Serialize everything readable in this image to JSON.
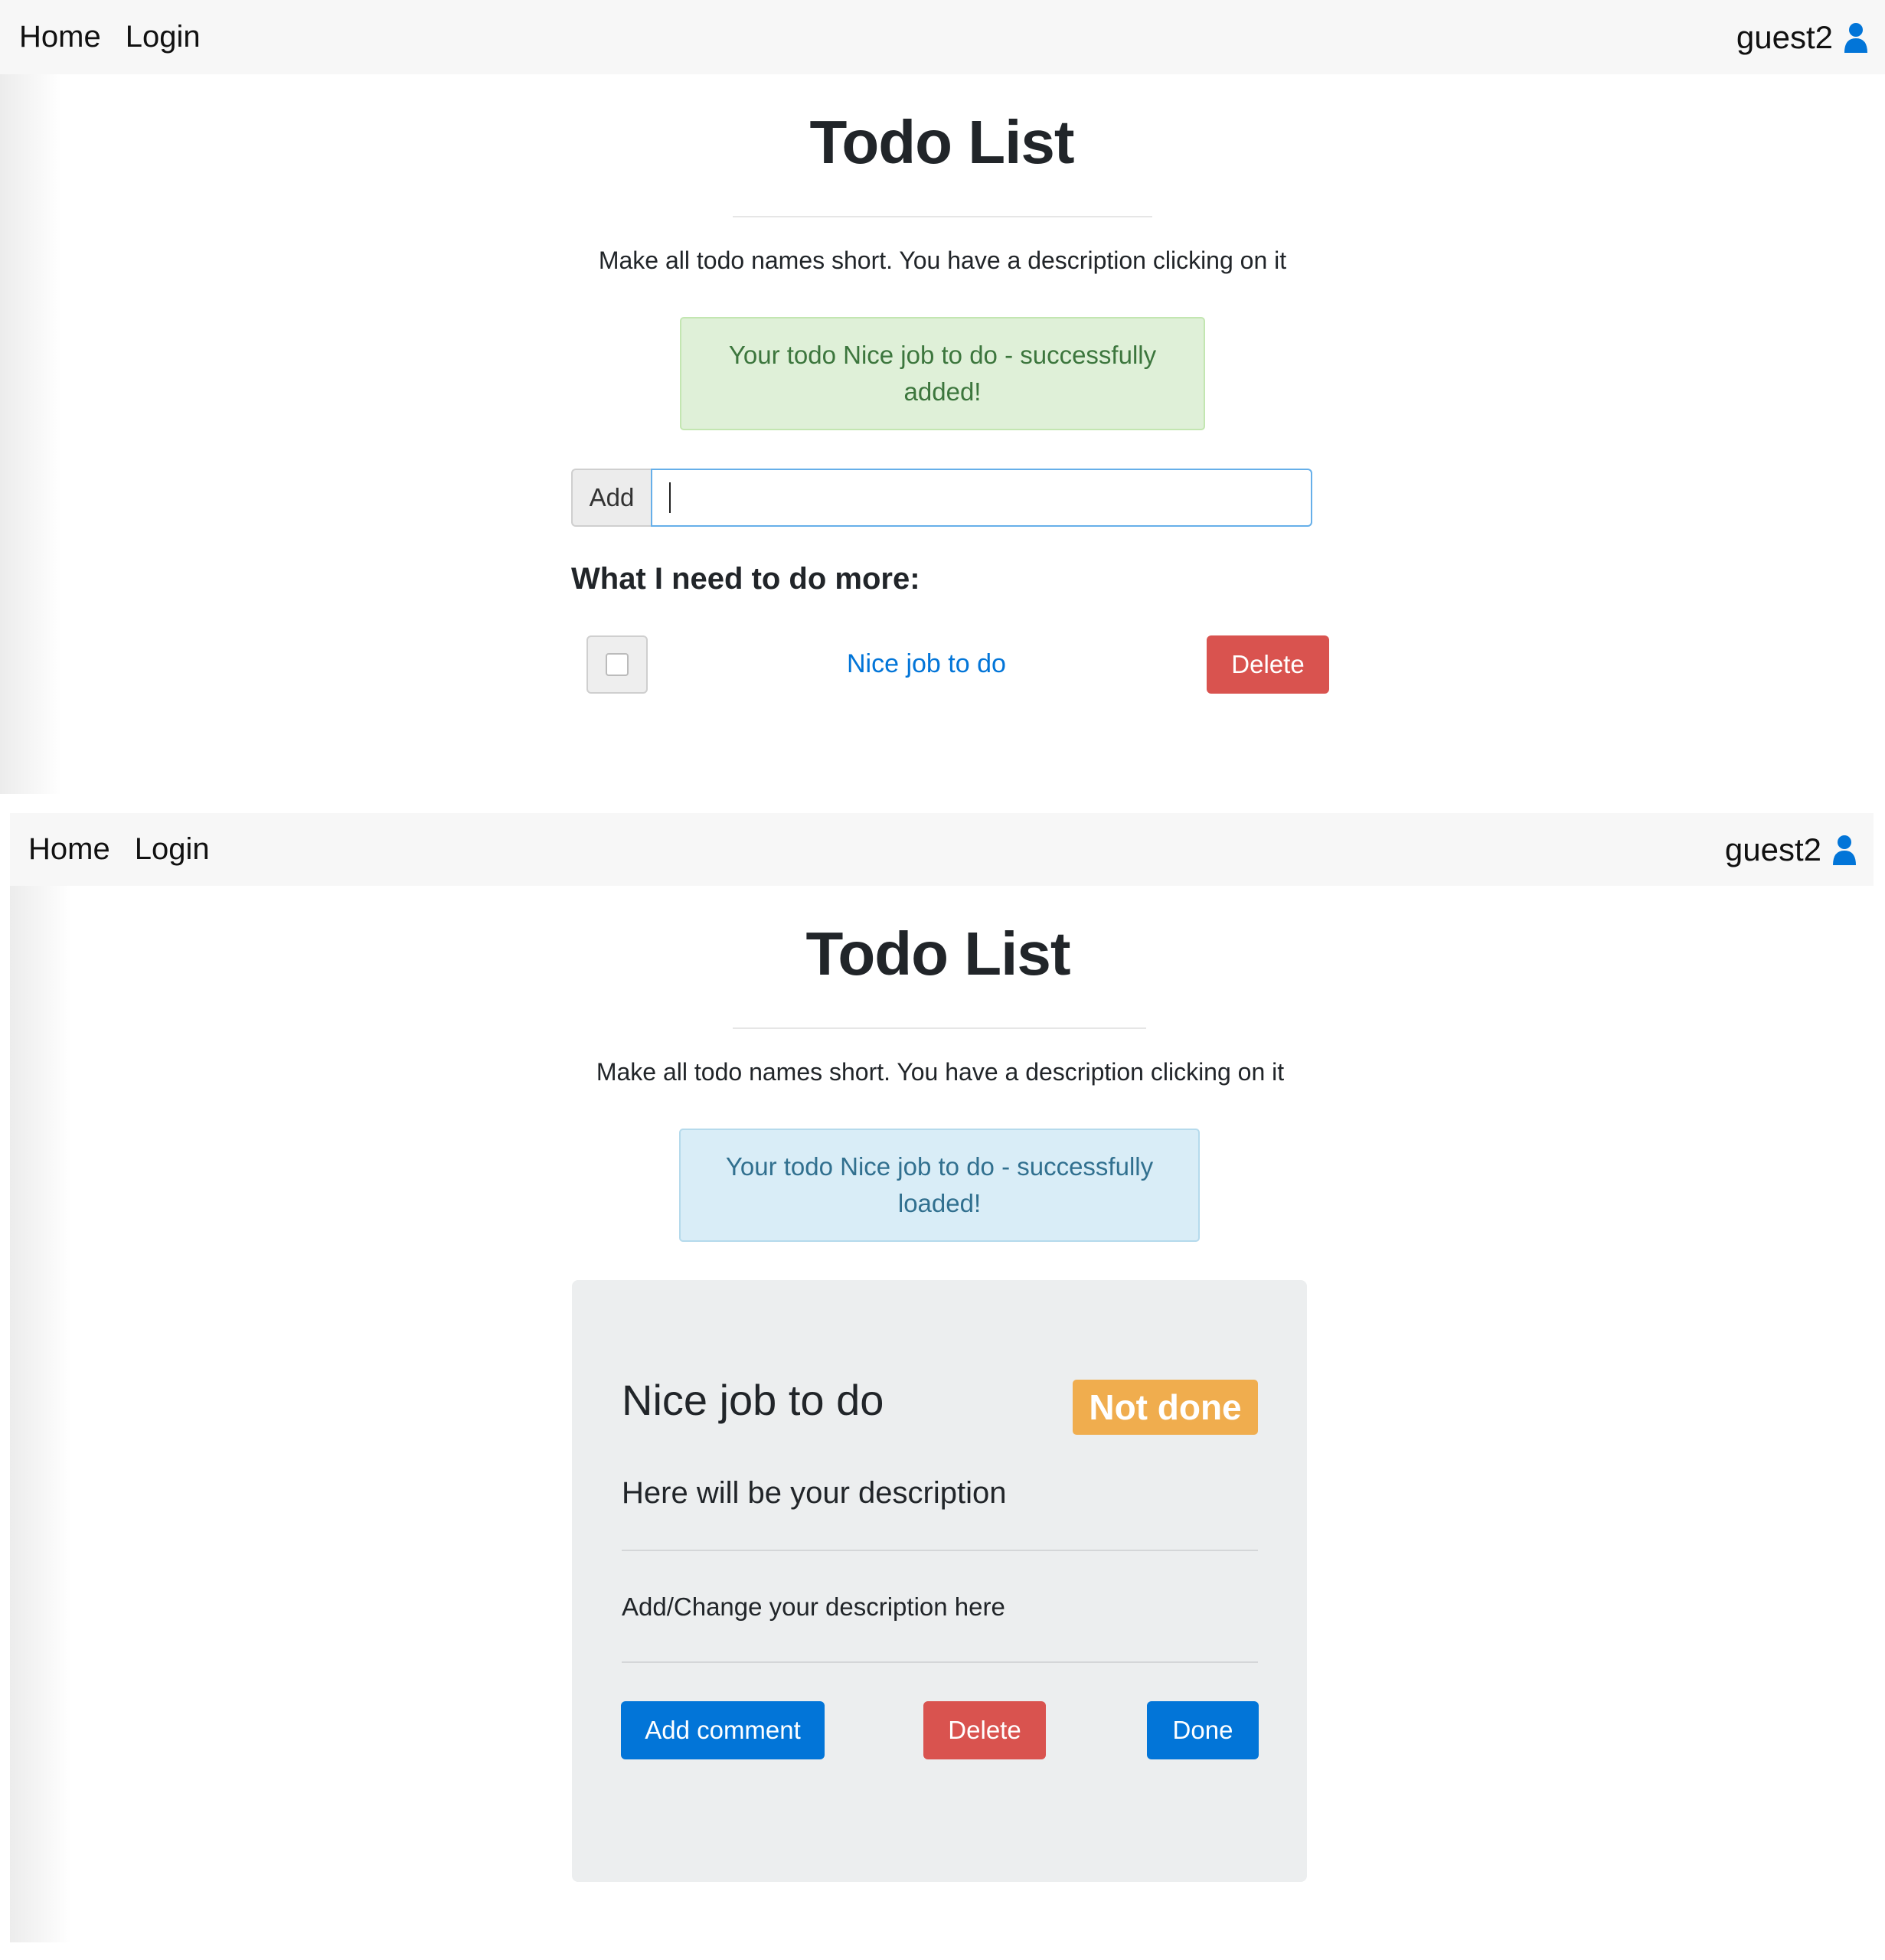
{
  "screens": [
    {
      "navbar": {
        "links": [
          "Home",
          "Login"
        ],
        "user": "guest2",
        "user_icon": "user-icon"
      },
      "title": "Todo List",
      "intro": "Make all todo names short. You have a description clicking on it",
      "alert": {
        "type": "success",
        "line1": "Your todo Nice job to do - successfully",
        "line2": "added!"
      },
      "add_form": {
        "button": "Add",
        "input_value": ""
      },
      "list_heading": "What I need to do more:",
      "todos": [
        {
          "name": "Nice job to do",
          "checked": false,
          "delete_label": "Delete"
        }
      ]
    },
    {
      "navbar": {
        "links": [
          "Home",
          "Login"
        ],
        "user": "guest2",
        "user_icon": "user-icon"
      },
      "title": "Todo List",
      "intro": "Make all todo names short. You have a description clicking on it",
      "alert": {
        "type": "info",
        "line1": "Your todo Nice job to do - successfully",
        "line2": "loaded!"
      },
      "detail": {
        "name": "Nice job to do",
        "status": "Not done",
        "description": "Here will be your description",
        "edit_prompt": "Add/Change your description here",
        "buttons": {
          "add_comment": "Add comment",
          "delete": "Delete",
          "done": "Done"
        }
      }
    }
  ],
  "colors": {
    "primary": "#0275d8",
    "danger": "#d9534f",
    "warning": "#f0ad4e",
    "success_bg": "#dff0d8",
    "info_bg": "#d9edf7",
    "navbar_bg": "#f7f7f7",
    "card_bg": "#eceeef"
  }
}
